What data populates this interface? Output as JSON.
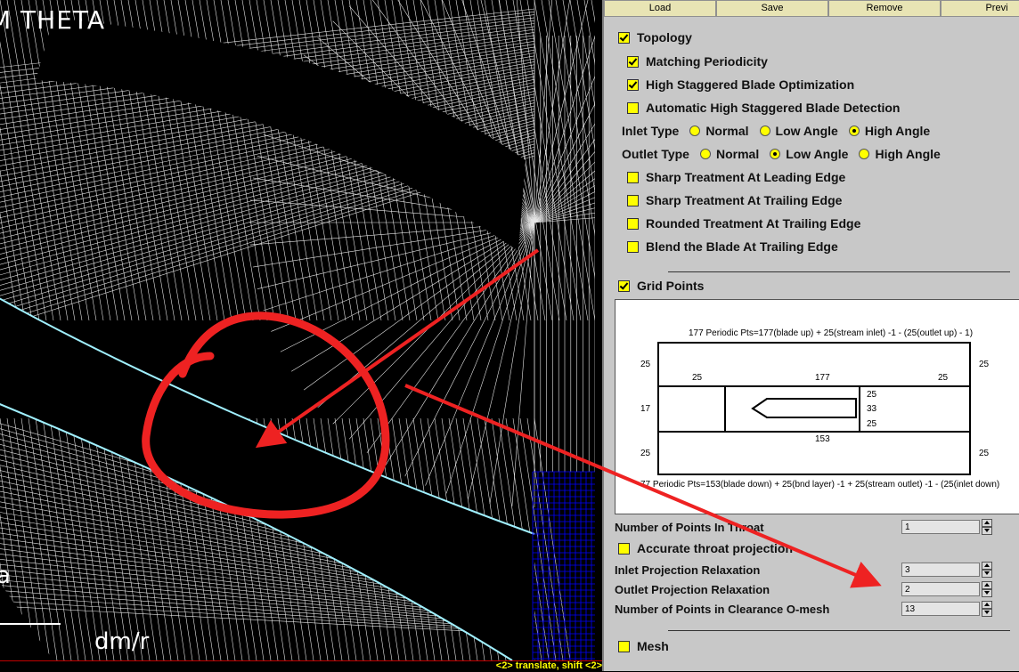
{
  "viewport": {
    "title": "M THETA",
    "axis_label": "dm/r",
    "side_letter": "a",
    "mesh_color": "#ffffff",
    "background": "#000000",
    "highlight_color": "#0000ff"
  },
  "status": {
    "text": "<2> translate, shift <2>"
  },
  "toolbar": {
    "buttons": [
      "Load",
      "Save",
      "Remove",
      "Previ"
    ]
  },
  "topology": {
    "label": "Topology",
    "checked": true,
    "options": [
      {
        "label": "Matching Periodicity",
        "checked": true
      },
      {
        "label": "High Staggered Blade Optimization",
        "checked": true
      },
      {
        "label": "Automatic High Staggered Blade Detection",
        "checked": false
      }
    ],
    "inlet_type": {
      "label": "Inlet Type",
      "choices": [
        "Normal",
        "Low Angle",
        "High Angle"
      ],
      "selected": "High Angle"
    },
    "outlet_type": {
      "label": "Outlet Type",
      "choices": [
        "Normal",
        "Low Angle",
        "High Angle"
      ],
      "selected": "Low Angle"
    },
    "edge_options": [
      {
        "label": "Sharp Treatment At Leading Edge",
        "checked": false
      },
      {
        "label": "Sharp Treatment At Trailing Edge",
        "checked": false
      },
      {
        "label": "Rounded Treatment At Trailing Edge",
        "checked": false
      },
      {
        "label": "Blend the Blade At Trailing Edge",
        "checked": false
      }
    ]
  },
  "grid_points": {
    "label": "Grid Points",
    "checked": true,
    "diagram": {
      "top_caption": "177 Periodic Pts=177(blade up) + 25(stream inlet) -1 - (25(outlet up) - 1)",
      "bottom_caption": "77 Periodic Pts=153(blade down) + 25(bnd layer) -1 + 25(stream outlet) -1 - (25(inlet down)",
      "numbers": {
        "left_top": "25",
        "right_top": "25",
        "inlet_top": "25",
        "blade_up": "177",
        "outlet_top": "25",
        "left_mid": "17",
        "te_top": "25",
        "te_mid": "33",
        "te_bot": "25",
        "blade_down": "153",
        "left_bot": "25",
        "right_bot": "25"
      }
    },
    "fields": [
      {
        "label": "Number of Points In Throat",
        "value": "1"
      },
      {
        "label": "Inlet Projection Relaxation",
        "value": "3"
      },
      {
        "label": "Outlet Projection Relaxation",
        "value": "2"
      },
      {
        "label": "Number of Points in Clearance O-mesh",
        "value": "13"
      }
    ],
    "accurate_throat": {
      "label": "Accurate throat projection",
      "checked": false
    }
  },
  "mesh": {
    "label": "Mesh",
    "checked": false
  },
  "annotation_color": "#ee2222"
}
